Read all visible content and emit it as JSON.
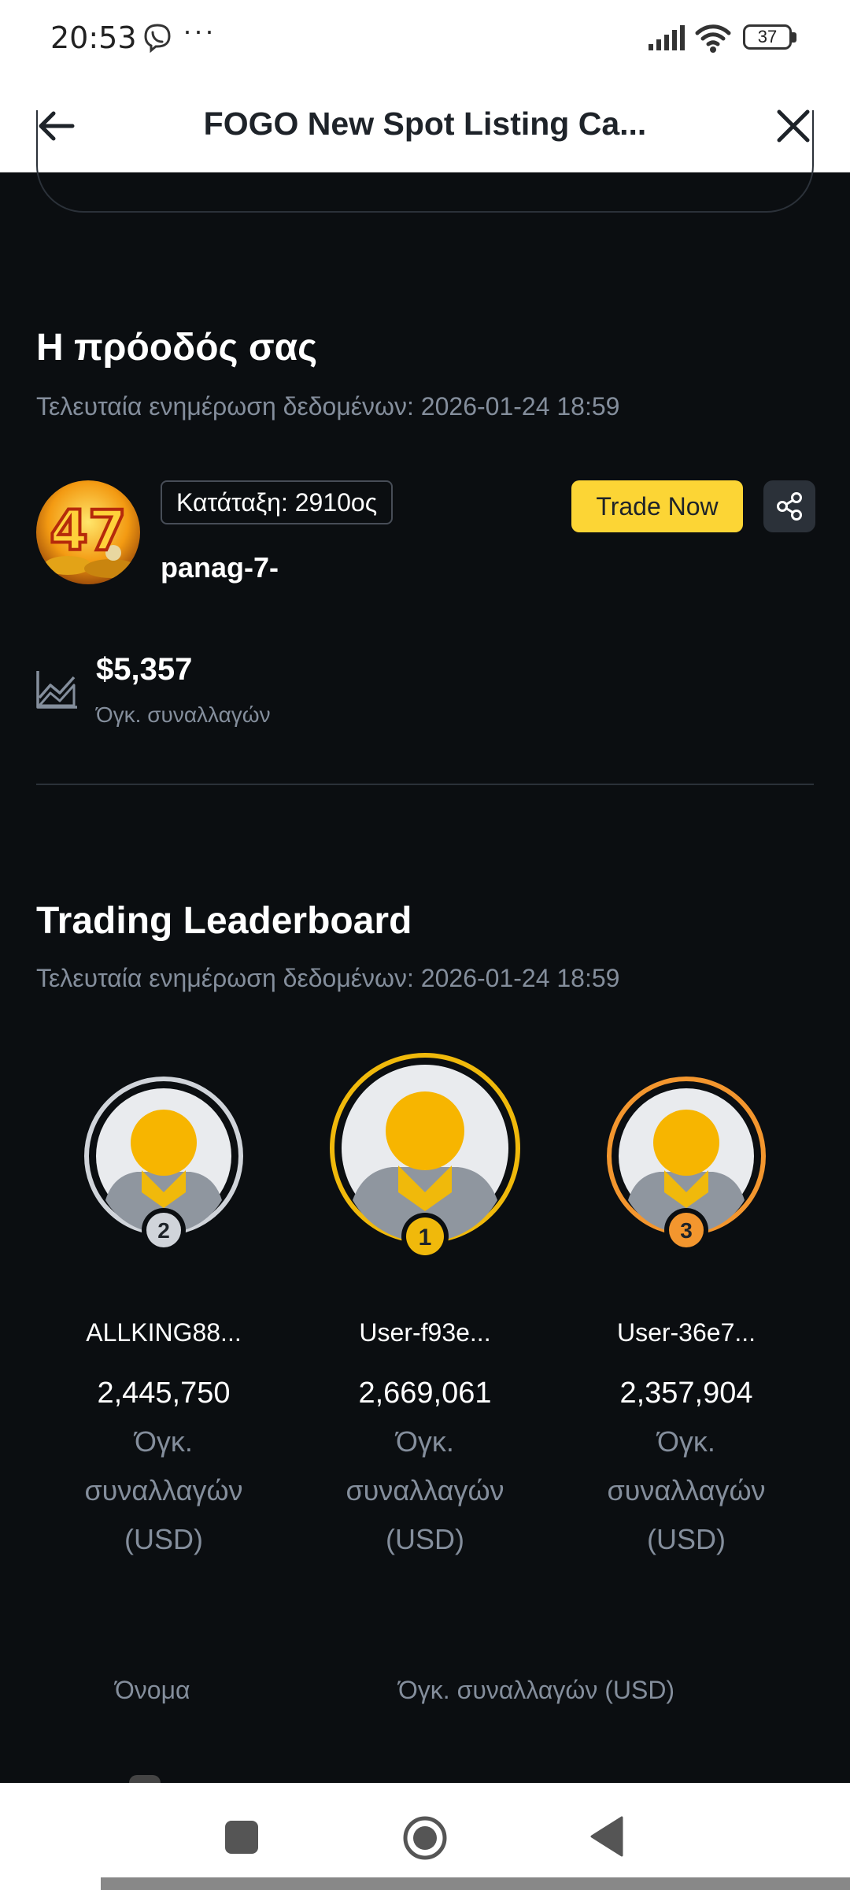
{
  "status_bar": {
    "time": "20:53",
    "dots": "···",
    "battery": "37"
  },
  "app_bar": {
    "title": "FOGO New Spot Listing Ca..."
  },
  "progress": {
    "title": "Η πρόοδός σας",
    "updated": "Τελευταία ενημέρωση δεδομένων: 2026-01-24 18:59",
    "rank": "Κατάταξη: 2910ος",
    "username": "panag-7-",
    "avatar_text": "47",
    "trade_button": "Trade Now",
    "volume_value": "$5,357",
    "volume_label": "Όγκ. συναλλαγών"
  },
  "leaderboard": {
    "title": "Trading Leaderboard",
    "updated": "Τελευταία ενημέρωση δεδομένων: 2026-01-24 18:59",
    "entries": [
      {
        "rank": "2",
        "name": "ALLKING88...",
        "volume": "2,445,750",
        "label_line1": "Όγκ.",
        "label_line2": "συναλλαγών",
        "label_line3": "(USD)",
        "color": "#d0d4da"
      },
      {
        "rank": "1",
        "name": "User-f93e...",
        "volume": "2,669,061",
        "label_line1": "Όγκ.",
        "label_line2": "συναλλαγών",
        "label_line3": "(USD)",
        "color": "#f0b90b"
      },
      {
        "rank": "3",
        "name": "User-36e7...",
        "volume": "2,357,904",
        "label_line1": "Όγκ.",
        "label_line2": "συναλλαγών",
        "label_line3": "(USD)",
        "color": "#f3962e"
      }
    ],
    "col_name": "Όνομα",
    "col_volume": "Όγκ. συναλλαγών (USD)"
  }
}
